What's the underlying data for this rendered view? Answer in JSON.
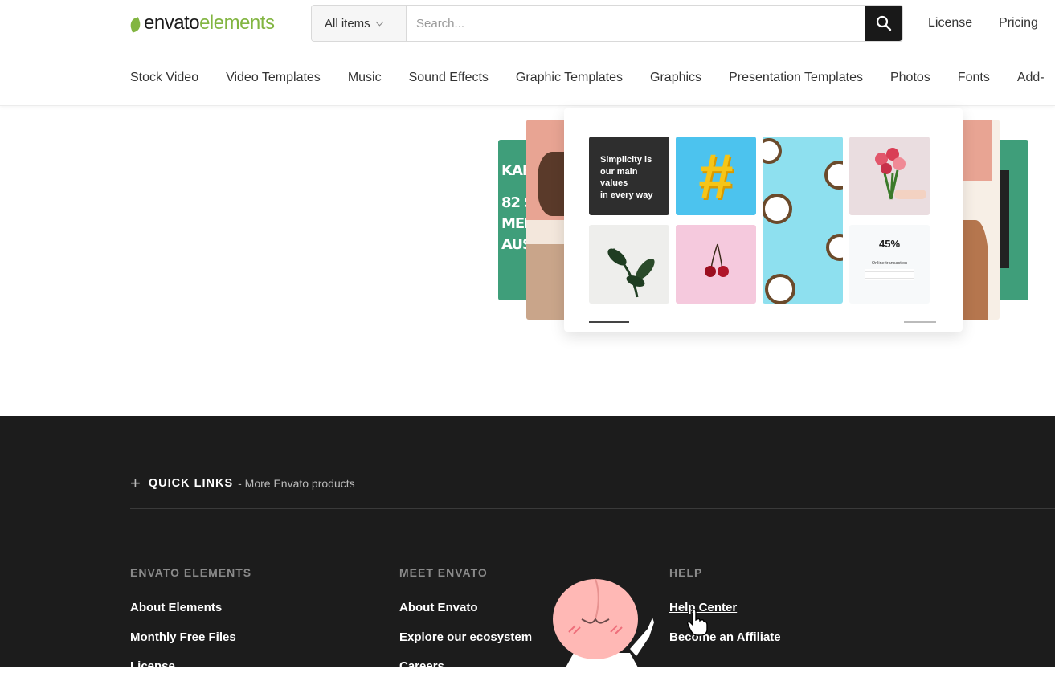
{
  "brand": {
    "logo_part1": "envato",
    "logo_part2": "elements",
    "green": "#82b541"
  },
  "search": {
    "category": "All items",
    "placeholder": "Search...",
    "button_icon": "search-icon"
  },
  "top_links": {
    "license": "License",
    "pricing": "Pricing"
  },
  "nav": [
    "Stock Video",
    "Video Templates",
    "Music",
    "Sound Effects",
    "Graphic Templates",
    "Graphics",
    "Presentation Templates",
    "Photos",
    "Fonts",
    "Add-"
  ],
  "preview": {
    "left_card_text": [
      "KAR",
      "82 S",
      "MEL",
      "AUS"
    ],
    "slogan": [
      "Simplicity is",
      "our main",
      "values",
      "in every way"
    ],
    "stat_value": "45%",
    "stat_caption": "Online transaction"
  },
  "footer": {
    "quick_links_title": "QUICK LINKS",
    "quick_links_sub": "- More Envato products",
    "columns": [
      {
        "heading": "ENVATO ELEMENTS",
        "links": [
          "About Elements",
          "Monthly Free Files",
          "License"
        ]
      },
      {
        "heading": "MEET ENVATO",
        "links": [
          "About Envato",
          "Explore our ecosystem",
          "Careers"
        ]
      },
      {
        "heading": "HELP",
        "links": [
          "Help Center",
          "Become an Affiliate"
        ]
      }
    ],
    "bg": "#1c1c1c"
  }
}
